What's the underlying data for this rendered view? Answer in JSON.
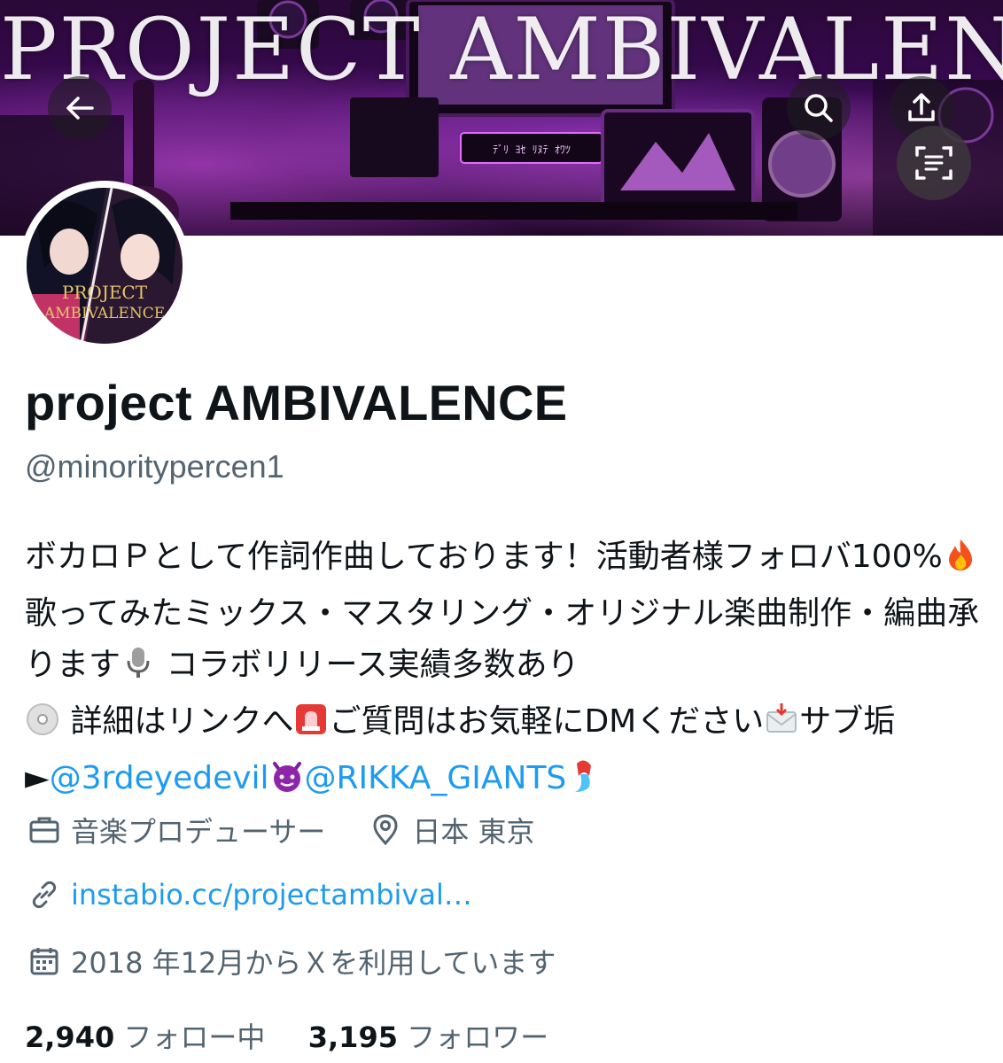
{
  "banner": {
    "title": "PROJECT AMBIVALENCE",
    "monitor_text": "ﾃﾞﾘ ﾖｾ ﾘﾇﾃ ｵﾜﾂ"
  },
  "avatar": {
    "line1": "PROJECT",
    "line2": "AMBIVALENCE"
  },
  "profile": {
    "name": "project AMBIVALENCE",
    "handle": "@minoritypercen1"
  },
  "bio": {
    "part1": "ボカロＰとして作詞作曲しております！活動者様フォロバ100%",
    "part2": "歌ってみたミックス・マスタリング・オリジナル楽曲制作・編曲承ります",
    "part3": " コラボリリース実績多数あり",
    "part4": " 詳細はリンクへ",
    "part5": "ご質問はお気軽にDMください",
    "part6": "サブ垢►",
    "mention1": "@3rdeyedevil",
    "mention2": "@RIKKA_GIANTS"
  },
  "meta": {
    "job": "音楽プロデューサー",
    "location": "日本 東京",
    "url": "instabio.cc/projectambival…",
    "joined": "2018 年12月からＸを利用しています"
  },
  "stats": {
    "following_count": "2,940",
    "following_label": "フォロー中",
    "followers_count": "3,195",
    "followers_label": "フォロワー"
  },
  "icons": {
    "back": "arrow-left-icon",
    "search": "search-icon",
    "share": "share-icon",
    "scan": "scan-text-icon",
    "job": "briefcase-icon",
    "location": "location-pin-icon",
    "link": "link-icon",
    "calendar": "calendar-icon"
  },
  "colors": {
    "link": "#1d9bf0",
    "secondary_text": "#536471",
    "primary_text": "#0f1419"
  }
}
